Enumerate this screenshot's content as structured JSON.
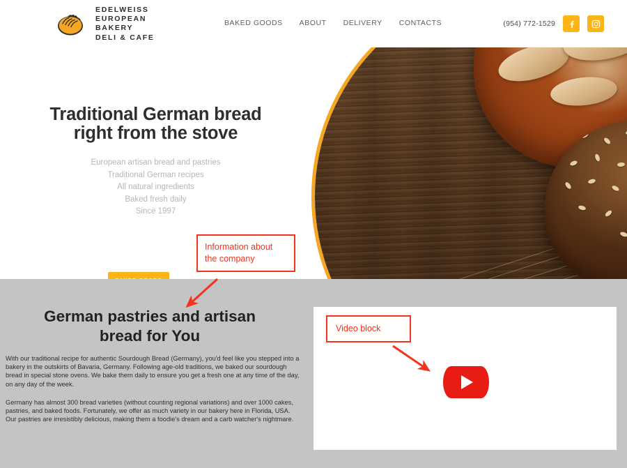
{
  "header": {
    "logo": {
      "icon": "bread-loaf-icon",
      "lines": [
        "EDELWEISS",
        "EUROPEAN",
        "BAKERY",
        "DELI & CAFE"
      ]
    },
    "nav": [
      {
        "label": "BAKED GOODS"
      },
      {
        "label": "ABOUT"
      },
      {
        "label": "DELIVERY"
      },
      {
        "label": "CONTACTS"
      }
    ],
    "phone": "(954) 772-1529",
    "social": [
      {
        "name": "facebook-icon",
        "label": "f"
      },
      {
        "name": "instagram-icon",
        "label": ""
      }
    ]
  },
  "hero": {
    "title_line1": "Traditional German bread",
    "title_line2": "right from the stove",
    "subtitle": [
      "European artisan bread and pastries",
      "Traditional German recipes",
      "All natural ingredients",
      "Baked fresh daily",
      "Since 1997"
    ],
    "cta_label": "BAKED GOODS",
    "image_alt": "artisan bread loaves on dark wooden table with wheat"
  },
  "about": {
    "title_line1": "German pastries and artisan",
    "title_line2": "bread for You",
    "paragraph1": "With our traditional recipe for authentic Sourdough Bread (Germany), you'd feel like you stepped into a bakery in the outskirts of Bavaria, Germany. Following age-old traditions, we baked our sourdough bread in special stone ovens. We bake them daily to ensure you get a fresh one at any time of the day, on any day of the week.",
    "paragraph2": "Germany has almost 300 bread varieties (without counting regional variations) and over 1000 cakes, pastries, and baked foods. Fortunately, we offer as much variety in our bakery here in Florida, USA. Our pastries are irresistibly delicious, making them a foodie's dream and a carb watcher's nightmare."
  },
  "video": {
    "play_icon": "youtube-play-icon"
  },
  "annotations": [
    {
      "id": "company",
      "text": "Information about the company"
    },
    {
      "id": "video",
      "text": "Video block"
    }
  ],
  "colors": {
    "accent_orange": "#FDB515",
    "hero_ring": "#F5A623",
    "annotation_red": "#F4331C",
    "play_red": "#e81c13",
    "section_gray": "#C4C4C4"
  }
}
